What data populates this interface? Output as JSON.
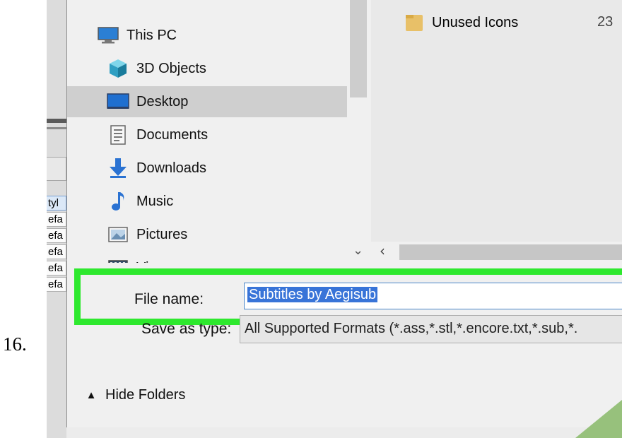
{
  "step_number": "16.",
  "background_app": {
    "rows": [
      "tyl",
      "efa",
      "efa",
      "efa",
      "efa",
      "efa"
    ]
  },
  "nav": {
    "items": [
      {
        "label": "This PC",
        "icon": "this-pc-icon",
        "selected": false
      },
      {
        "label": "3D Objects",
        "icon": "3d-objects-icon",
        "selected": false
      },
      {
        "label": "Desktop",
        "icon": "desktop-icon",
        "selected": true
      },
      {
        "label": "Documents",
        "icon": "documents-icon",
        "selected": false
      },
      {
        "label": "Downloads",
        "icon": "downloads-icon",
        "selected": false
      },
      {
        "label": "Music",
        "icon": "music-icon",
        "selected": false
      },
      {
        "label": "Pictures",
        "icon": "pictures-icon",
        "selected": false
      },
      {
        "label": "Vi",
        "icon": "videos-icon",
        "selected": false
      }
    ]
  },
  "files": [
    {
      "name": "Unused Icons",
      "date": "23",
      "icon": "folder-icon"
    }
  ],
  "save_form": {
    "file_name_label": "File name:",
    "file_name_value": "Subtitles by Aegisub",
    "save_as_type_label": "Save as type:",
    "save_as_type_value": "All Supported Formats (*.ass,*.stl,*.encore.txt,*.sub,*.",
    "hide_folders_label": "Hide Folders"
  },
  "colors": {
    "highlight": "#2ee82e",
    "selection": "#3874d8",
    "nav_selected": "#cfcfcf",
    "folder": "#e8c068"
  }
}
